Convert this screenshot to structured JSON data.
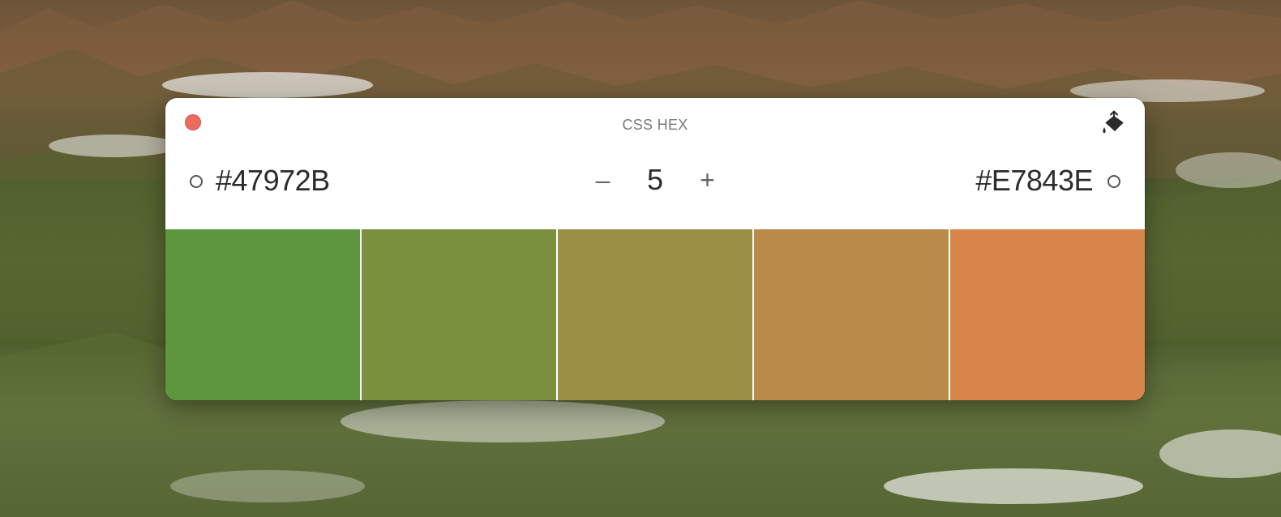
{
  "window": {
    "title": "CSS HEX"
  },
  "start_color": {
    "hex": "#47972B"
  },
  "end_color": {
    "hex": "#E7843E"
  },
  "steps": {
    "value": "5",
    "decrement_label": "–",
    "increment_label": "+"
  },
  "icons": {
    "close": "close-icon",
    "paint": "paint-bucket-icon"
  },
  "colors": {
    "close_button": "#ED6A5E"
  },
  "swatches": [
    {
      "color": "#5D963C"
    },
    {
      "color": "#7A903E"
    },
    {
      "color": "#9B8E45"
    },
    {
      "color": "#BA8A4B"
    },
    {
      "color": "#D9864B"
    }
  ]
}
